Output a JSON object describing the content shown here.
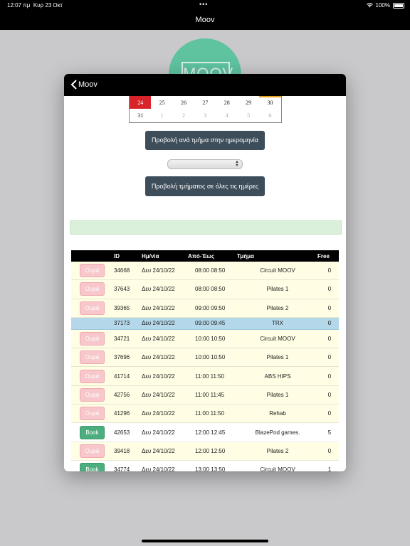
{
  "status_bar": {
    "time": "12:07 πμ",
    "date": "Κυρ 23 Οκτ",
    "battery": "100%"
  },
  "app": {
    "title": "Moov",
    "logo_text": "MOOV"
  },
  "modal": {
    "back_label": "Moov"
  },
  "calendar": {
    "rows": [
      [
        {
          "day": "24",
          "state": "today"
        },
        {
          "day": "25",
          "state": ""
        },
        {
          "day": "26",
          "state": ""
        },
        {
          "day": "27",
          "state": ""
        },
        {
          "day": "28",
          "state": ""
        },
        {
          "day": "29",
          "state": ""
        },
        {
          "day": "30",
          "state": "marked"
        }
      ],
      [
        {
          "day": "31",
          "state": ""
        },
        {
          "day": "1",
          "state": "muted"
        },
        {
          "day": "2",
          "state": "muted"
        },
        {
          "day": "3",
          "state": "muted"
        },
        {
          "day": "4",
          "state": "muted"
        },
        {
          "day": "5",
          "state": "muted"
        },
        {
          "day": "6",
          "state": "muted"
        }
      ]
    ],
    "colors": {
      "today": "#d8232a",
      "marked": "#e6a21f"
    }
  },
  "buttons": {
    "view_by_date": "Προβολή ανά τμήμα στην ημερομηνία",
    "view_all_days": "Προβολή τμήματος σε όλες τις ημέρες"
  },
  "select": {
    "value": ""
  },
  "table": {
    "headers": {
      "id": "ID",
      "date": "Ημ/νία",
      "time": "Από-Έως",
      "dept": "Τμήμα",
      "free": "Free"
    },
    "rows": [
      {
        "action": "Ουρά",
        "id": "34668",
        "date": "Δευ 24/10/22",
        "time": "08:00 08:50",
        "dept": "Circuit MOOV",
        "free": "0"
      },
      {
        "action": "Ουρά",
        "id": "37643",
        "date": "Δευ 24/10/22",
        "time": "08:00 08:50",
        "dept": "Pilates 1",
        "free": "0"
      },
      {
        "action": "Ουρά",
        "id": "39365",
        "date": "Δευ 24/10/22",
        "time": "09:00 09:50",
        "dept": "Pilates 2",
        "free": "0"
      },
      {
        "action": "",
        "id": "37173",
        "date": "Δευ 24/10/22",
        "time": "09:00 09:45",
        "dept": "TRX",
        "free": "0",
        "selected": true
      },
      {
        "action": "Ουρά",
        "id": "34721",
        "date": "Δευ 24/10/22",
        "time": "10:00 10:50",
        "dept": "Circuit MOOV",
        "free": "0"
      },
      {
        "action": "Ουρά",
        "id": "37696",
        "date": "Δευ 24/10/22",
        "time": "10:00 10:50",
        "dept": "Pilates 1",
        "free": "0"
      },
      {
        "action": "Ουρά",
        "id": "41714",
        "date": "Δευ 24/10/22",
        "time": "11:00 11:50",
        "dept": "ABS HIPS",
        "free": "0"
      },
      {
        "action": "Ουρά",
        "id": "42756",
        "date": "Δευ 24/10/22",
        "time": "11:00 11:45",
        "dept": "Pilates 1",
        "free": "0"
      },
      {
        "action": "Ουρά",
        "id": "41296",
        "date": "Δευ 24/10/22",
        "time": "11:00 11:50",
        "dept": "Rehab",
        "free": "0"
      },
      {
        "action": "Book",
        "id": "42653",
        "date": "Δευ 24/10/22",
        "time": "12:00 12:45",
        "dept": "BlazePod games.",
        "free": "5"
      },
      {
        "action": "Ουρά",
        "id": "39418",
        "date": "Δευ 24/10/22",
        "time": "12:00 12:50",
        "dept": "Pilates 2",
        "free": "0"
      },
      {
        "action": "Book",
        "id": "34774",
        "date": "Δευ 24/10/22",
        "time": "13:00 13:50",
        "dept": "Circuit MOOV",
        "free": "1"
      }
    ]
  }
}
